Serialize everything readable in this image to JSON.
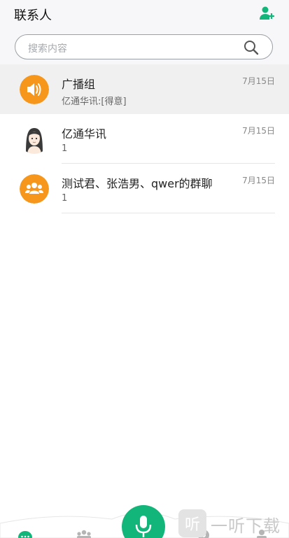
{
  "header": {
    "title": "联系人",
    "add_icon": "add-contact-icon"
  },
  "search": {
    "placeholder": "搜索内容",
    "icon": "search-icon"
  },
  "conversations": [
    {
      "name": "广播组",
      "subtitle": "亿通华讯:[得意]",
      "date": "7月15日",
      "avatar": "broadcast-icon",
      "avatar_color": "#f6961b",
      "active": true
    },
    {
      "name": "亿通华讯",
      "subtitle": "1",
      "date": "7月15日",
      "avatar": "user-avatar",
      "active": false
    },
    {
      "name": "测试君、张浩男、qwer的群聊",
      "subtitle": "1",
      "date": "7月15日",
      "avatar": "group-icon",
      "avatar_color": "#f6961b",
      "active": false
    }
  ],
  "bottom_nav": {
    "tabs": [
      {
        "icon": "chat-icon",
        "active": true
      },
      {
        "icon": "contacts-icon",
        "active": false
      },
      {
        "icon": "mic-icon",
        "active": false
      },
      {
        "icon": "discover-icon",
        "active": false
      },
      {
        "icon": "profile-icon",
        "active": false
      }
    ]
  },
  "watermark": {
    "text": "一听下载",
    "glyph": "听"
  },
  "colors": {
    "accent": "#12b57a",
    "orange": "#f6961b"
  }
}
